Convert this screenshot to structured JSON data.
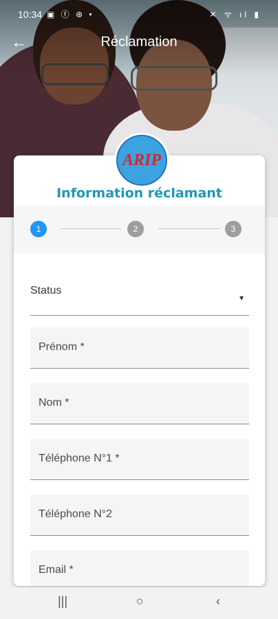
{
  "status_bar": {
    "time": "10:34",
    "left_icons": "▣ ⓕ ⊛ •",
    "right_icons": "✕ ᯤ ıl ▮"
  },
  "app_bar": {
    "back_icon": "arrow-left-icon",
    "title": "Réclamation"
  },
  "card": {
    "logo_text": "ARIP",
    "title": "Information réclamant",
    "steps": [
      "1",
      "2",
      "3"
    ],
    "active_step": 1,
    "status": {
      "label": "Status",
      "arrow": "▾"
    },
    "fields": [
      {
        "label": "Prénom *"
      },
      {
        "label": "Nom *"
      },
      {
        "label": "Téléphone N°1 *"
      },
      {
        "label": "Téléphone N°2"
      },
      {
        "label": "Email *"
      }
    ]
  },
  "nav_bar": {
    "recent": "|||",
    "home": "○",
    "back": "‹"
  },
  "colors": {
    "accent": "#2196f3",
    "title": "#2196b9",
    "inactive_step": "#9e9e9e"
  }
}
